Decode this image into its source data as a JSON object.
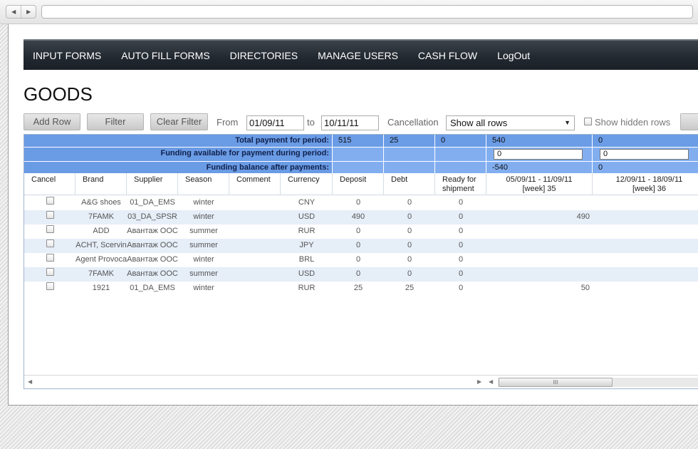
{
  "nav": {
    "items": [
      {
        "label": "INPUT FORMS"
      },
      {
        "label": "AUTO FILL FORMS"
      },
      {
        "label": "DIRECTORIES"
      },
      {
        "label": "MANAGE USERS"
      },
      {
        "label": "CASH FLOW"
      },
      {
        "label": "LogOut"
      }
    ]
  },
  "page": {
    "title": "GOODS"
  },
  "toolbar": {
    "add_row": "Add Row",
    "filter": "Filter",
    "clear_filter": "Clear Filter",
    "from_label": "From",
    "from_value": "01/09/11",
    "to_label": "to",
    "to_value": "10/11/11",
    "cancellation_label": "Cancellation",
    "cancellation_value": "Show all rows",
    "show_hidden_label": "Show hidden rows"
  },
  "summary": {
    "total": {
      "label": "Total payment for period:",
      "deposit": "515",
      "debt": "25",
      "ready": "0",
      "week35": "540",
      "week36": "0"
    },
    "funding": {
      "label": "Funding available for payment during period:",
      "week35": "0",
      "week36": "0"
    },
    "balance": {
      "label": "Funding balance after payments:",
      "week35": "-540",
      "week36": "0"
    }
  },
  "table": {
    "headers": {
      "cancel": "Cancel",
      "brand": "Brand",
      "supplier": "Supplier",
      "season": "Season",
      "comment": "Comment",
      "currency": "Currency",
      "deposit": "Deposit",
      "debt": "Debt",
      "ready_line1": "Ready for",
      "ready_line2": "shipment",
      "week35_line1": "05/09/11 - 11/09/11",
      "week35_line2": "[week] 35",
      "week36_line1": "12/09/11 - 18/09/11",
      "week36_line2": "[week] 36"
    },
    "rows": [
      {
        "brand": "A&G shoes",
        "supplier": "01_DA_EMS",
        "season": "winter",
        "comment": "",
        "currency": "CNY",
        "deposit": "0",
        "debt": "0",
        "ready": "0",
        "week35": "",
        "week36": ""
      },
      {
        "brand": "7FAMK",
        "supplier": "03_DA_SPSR",
        "season": "winter",
        "comment": "",
        "currency": "USD",
        "deposit": "490",
        "debt": "0",
        "ready": "0",
        "week35": "490",
        "week36": ""
      },
      {
        "brand": "ADD",
        "supplier": "Авантаж ООС",
        "season": "summer",
        "comment": "",
        "currency": "RUR",
        "deposit": "0",
        "debt": "0",
        "ready": "0",
        "week35": "",
        "week36": ""
      },
      {
        "brand": "ACHT, Scervin",
        "supplier": "Авантаж ООС",
        "season": "summer",
        "comment": "",
        "currency": "JPY",
        "deposit": "0",
        "debt": "0",
        "ready": "0",
        "week35": "",
        "week36": ""
      },
      {
        "brand": "Agent Provoca",
        "supplier": "Авантаж ООС",
        "season": "winter",
        "comment": "",
        "currency": "BRL",
        "deposit": "0",
        "debt": "0",
        "ready": "0",
        "week35": "",
        "week36": ""
      },
      {
        "brand": "7FAMK",
        "supplier": "Авантаж ООС",
        "season": "summer",
        "comment": "",
        "currency": "USD",
        "deposit": "0",
        "debt": "0",
        "ready": "0",
        "week35": "",
        "week36": ""
      },
      {
        "brand": "1921",
        "supplier": "01_DA_EMS",
        "season": "winter",
        "comment": "",
        "currency": "RUR",
        "deposit": "25",
        "debt": "25",
        "ready": "0",
        "week35": "50",
        "week36": ""
      }
    ]
  },
  "scrollbar": {
    "thumb_glyph": "III"
  },
  "colors": {
    "menubar": "#222830",
    "summary": "#6b9ce6",
    "alt_row": "#e6eef8"
  }
}
